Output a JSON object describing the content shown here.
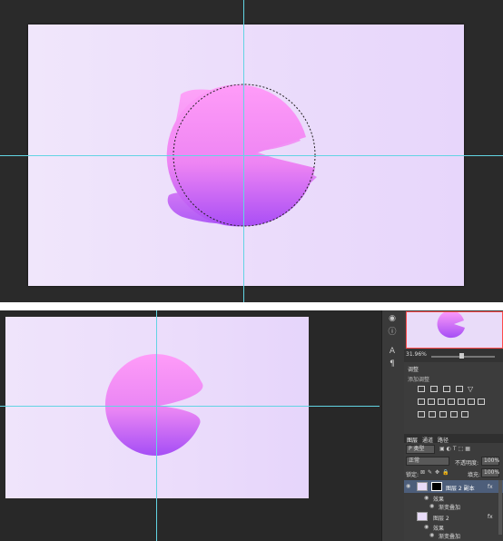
{
  "colors": {
    "canvas_left": "#f0e6fb",
    "canvas_right": "#e7d6fb",
    "shape_top": "#ff9cf8",
    "shape_bottom": "#b14df4",
    "guide": "#62d4e3",
    "selection_outline": "#222222",
    "panel_bg": "#3c3c3c",
    "highlight_row": "#4d5e7a"
  },
  "tools": [
    "eye-icon",
    "info-icon",
    "text-style-icon",
    "paragraph-icon"
  ],
  "navigator": {
    "zoom": "31.96%"
  },
  "adjustments": {
    "tab": "调整",
    "subtitle": "添加调整",
    "row1_icons": [
      "brightness-icon",
      "levels-icon",
      "curves-icon",
      "exposure-icon",
      "gradient-triangle-icon"
    ],
    "row2_icons": [
      "vibrance-icon",
      "hue-icon",
      "color-balance-icon",
      "black-white-icon",
      "photo-filter-icon",
      "channel-mixer-icon",
      "grid-icon"
    ],
    "row3_icons": [
      "invert-icon",
      "posterize-icon",
      "threshold-icon",
      "selective-color-icon",
      "gradient-map-icon"
    ]
  },
  "layers_panel": {
    "tabs": [
      "图层",
      "通道",
      "路径"
    ],
    "filter": "P 类型",
    "blend_mode": "正常",
    "opacity_label": "不透明度:",
    "opacity_value": "100%",
    "lock_label": "锁定:",
    "fill_label": "填充:",
    "fill_value": "100%",
    "layers": [
      {
        "name": "图层 2 副本",
        "fx": "fx",
        "selected": true
      },
      {
        "name": "效果",
        "sub": true
      },
      {
        "name": "渐变叠加",
        "sub": true
      },
      {
        "name": "图层 2",
        "fx": "fx",
        "selected": false
      },
      {
        "name": "效果",
        "sub": true
      },
      {
        "name": "渐变叠加",
        "sub": true
      }
    ]
  }
}
